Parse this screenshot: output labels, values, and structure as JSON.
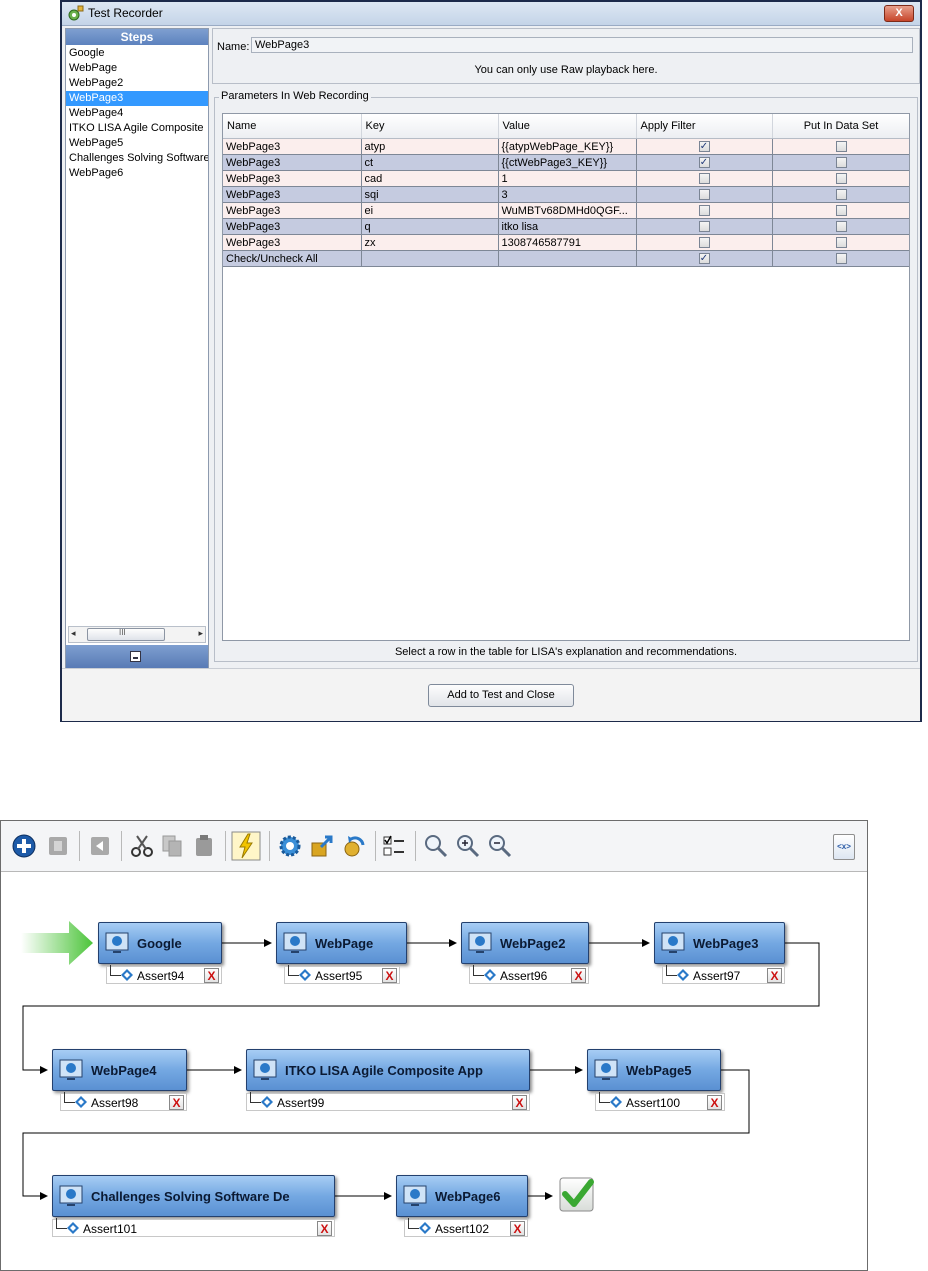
{
  "window": {
    "title": "Test Recorder",
    "close_label": "X"
  },
  "steps": {
    "header": "Steps",
    "items": [
      "Google",
      "WebPage",
      "WebPage2",
      "WebPage3",
      "WebPage4",
      "ITKO LISA  Agile Composite",
      "WebPage5",
      "Challenges Solving Software",
      "WebPage6"
    ],
    "selected": "WebPage3",
    "scroll_grip": "III",
    "scroll_left": "◂",
    "scroll_right": "▸"
  },
  "name_field": {
    "label": "Name:",
    "value": "WebPage3",
    "note": "You can only use Raw playback here."
  },
  "params": {
    "legend": "Parameters In Web Recording",
    "columns": [
      "Name",
      "Key",
      "Value",
      "Apply Filter",
      "Put In Data Set"
    ],
    "rows": [
      {
        "name": "WebPage3",
        "key": "atyp",
        "value": "{{atypWebPage_KEY}}",
        "apply": true,
        "put": false
      },
      {
        "name": "WebPage3",
        "key": "ct",
        "value": "{{ctWebPage3_KEY}}",
        "apply": true,
        "put": false
      },
      {
        "name": "WebPage3",
        "key": "cad",
        "value": "1",
        "apply": false,
        "put": false
      },
      {
        "name": "WebPage3",
        "key": "sqi",
        "value": "3",
        "apply": false,
        "put": false
      },
      {
        "name": "WebPage3",
        "key": "ei",
        "value": "WuMBTv68DMHd0QGF...",
        "apply": false,
        "put": false
      },
      {
        "name": "WebPage3",
        "key": "q",
        "value": "itko lisa",
        "apply": false,
        "put": false
      },
      {
        "name": "WebPage3",
        "key": "zx",
        "value": "1308746587791",
        "apply": false,
        "put": false
      },
      {
        "name": "Check/Uncheck All",
        "key": "",
        "value": "",
        "apply": true,
        "put": false
      }
    ],
    "hint": "Select a row in the table for LISA's explanation and recommendations."
  },
  "buttons": {
    "add_close": "Add to Test and Close"
  },
  "flow": {
    "xml_label": "<x>",
    "nodes": [
      {
        "label": "Google",
        "assert": "Assert94"
      },
      {
        "label": "WebPage",
        "assert": "Assert95"
      },
      {
        "label": "WebPage2",
        "assert": "Assert96"
      },
      {
        "label": "WebPage3",
        "assert": "Assert97"
      },
      {
        "label": "WebPage4",
        "assert": "Assert98"
      },
      {
        "label": "ITKO LISA  Agile Composite App",
        "assert": "Assert99"
      },
      {
        "label": "WebPage5",
        "assert": "Assert100"
      },
      {
        "label": "Challenges Solving Software De",
        "assert": "Assert101"
      },
      {
        "label": "WebPage6",
        "assert": "Assert102"
      }
    ]
  },
  "colors": {
    "selection": "#3399ff",
    "row_light": "#fbeeed",
    "row_dark": "#c5cbe0",
    "node_blue": "#74a8e2",
    "start_arrow": "#4cc43a",
    "end_check": "#3aa832"
  }
}
